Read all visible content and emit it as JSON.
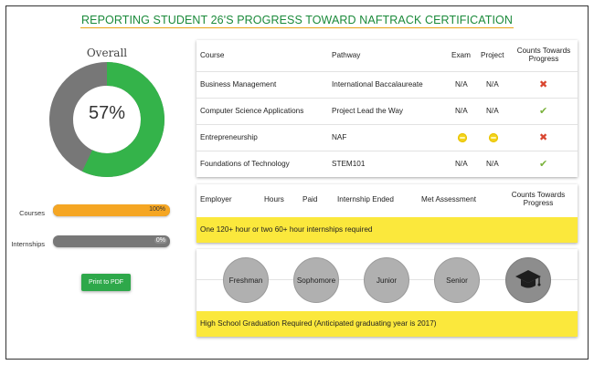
{
  "title": "REPORTING STUDENT 26'S PROGRESS TOWARD NAFTRACK CERTIFICATION",
  "overall": {
    "label": "Overall",
    "percent_text": "57%",
    "percent": 57
  },
  "progress_bars": [
    {
      "label": "Courses",
      "pct_text": "100%",
      "value": 100,
      "color": "#f5a623"
    },
    {
      "label": "Internships",
      "pct_text": "0%",
      "value": 0,
      "color": "#777777"
    }
  ],
  "print_button": "Print to PDF",
  "courses": {
    "headers": {
      "course": "Course",
      "pathway": "Pathway",
      "exam": "Exam",
      "project": "Project",
      "counts": "Counts Towards Progress"
    },
    "rows": [
      {
        "course": "Business Management",
        "pathway": "International Baccalaureate",
        "exam": "N/A",
        "project": "N/A",
        "status": "x"
      },
      {
        "course": "Computer Science Applications",
        "pathway": "Project Lead the Way",
        "exam": "N/A",
        "project": "N/A",
        "status": "check"
      },
      {
        "course": "Entrepreneurship",
        "pathway": "NAF",
        "exam": "",
        "project": "",
        "status": "x"
      },
      {
        "course": "Foundations of Technology",
        "pathway": "STEM101",
        "exam": "N/A",
        "project": "N/A",
        "status": "check"
      }
    ]
  },
  "internships": {
    "headers": {
      "employer": "Employer",
      "hours": "Hours",
      "paid": "Paid",
      "ended": "Internship Ended",
      "assessment": "Met Assessment",
      "counts": "Counts Towards Progress"
    },
    "requirement": "One 120+ hour or two 60+ hour internships required"
  },
  "grades": {
    "levels": [
      "Freshman",
      "Sophomore",
      "Junior",
      "Senior"
    ],
    "requirement": "High School Graduation Required (Anticipated graduating year is 2017)"
  },
  "colors": {
    "green": "#2ea84a",
    "orange": "#f5a623",
    "gray": "#777777",
    "yellow": "#fbe83c",
    "red": "#d9452f",
    "check": "#7ab23c"
  },
  "icons": {
    "x_mark": "✖",
    "check_mark": "✔",
    "graduation": "graduation-cap-icon"
  }
}
